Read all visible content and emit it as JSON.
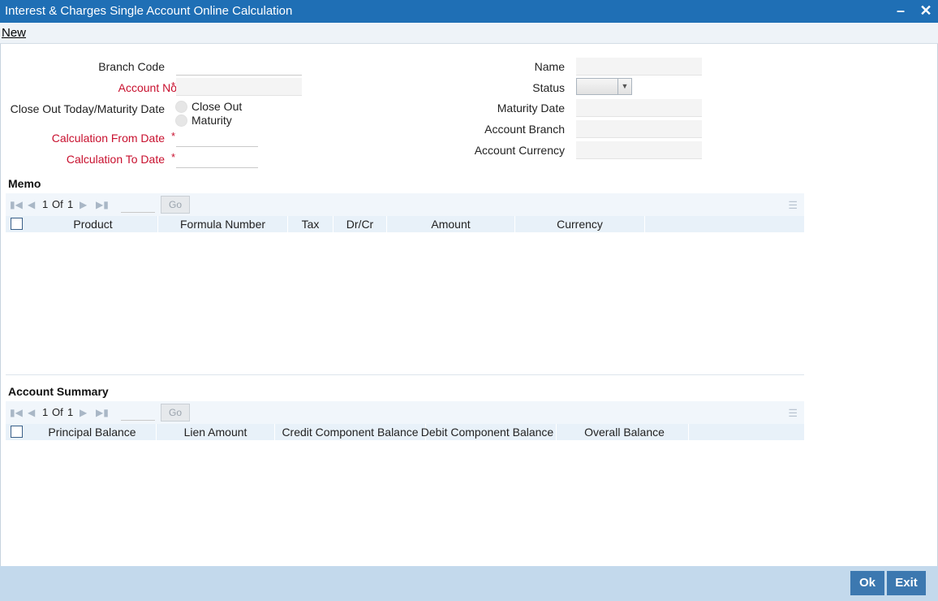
{
  "window": {
    "title": "Interest & Charges Single Account Online Calculation",
    "minimize_icon": "minimize-icon",
    "close_icon": "close-icon"
  },
  "menu": {
    "new_label": "New"
  },
  "form": {
    "branch_code_label": "Branch Code",
    "account_no_label": "Account No",
    "close_out_label": "Close Out Today/Maturity Date",
    "close_out_option": "Close Out",
    "maturity_option": "Maturity",
    "calc_from_label": "Calculation From Date",
    "calc_to_label": "Calculation To Date",
    "name_label": "Name",
    "status_label": "Status",
    "maturity_date_label": "Maturity Date",
    "account_branch_label": "Account Branch",
    "account_currency_label": "Account Currency",
    "required_mark": "*"
  },
  "memo": {
    "title": "Memo",
    "pager": {
      "page": "1",
      "of_label": "Of",
      "total": "1",
      "go_label": "Go"
    },
    "columns": [
      "Product",
      "Formula Number",
      "Tax",
      "Dr/Cr",
      "Amount",
      "Currency"
    ]
  },
  "summary": {
    "title": "Account Summary",
    "pager": {
      "page": "1",
      "of_label": "Of",
      "total": "1",
      "go_label": "Go"
    },
    "columns": [
      "Principal Balance",
      "Lien Amount",
      "Credit Component Balance",
      "Debit Component Balance",
      "Overall Balance"
    ]
  },
  "footer": {
    "ok_label": "Ok",
    "exit_label": "Exit"
  },
  "colors": {
    "titlebar": "#1f6fb5",
    "required": "#c8102e",
    "footer": "#c3d9ec",
    "button": "#3c78b0"
  }
}
